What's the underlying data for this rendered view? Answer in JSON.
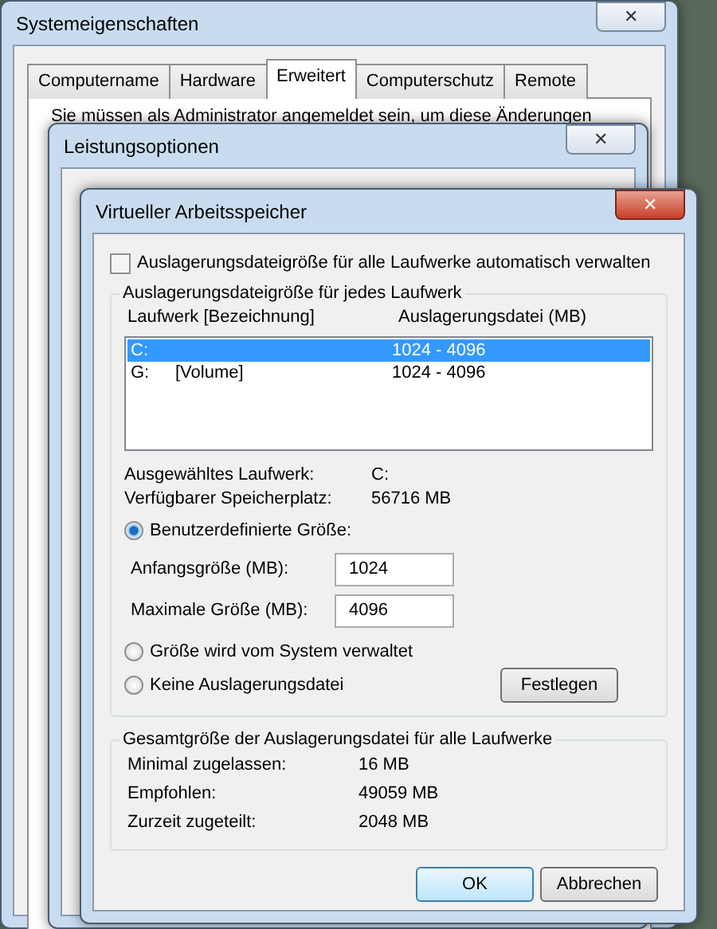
{
  "system_properties": {
    "title": "Systemeigenschaften",
    "close": "✕",
    "tabs": [
      {
        "label": "Computername",
        "selected": false
      },
      {
        "label": "Hardware",
        "selected": false
      },
      {
        "label": "Erweitert",
        "selected": true
      },
      {
        "label": "Computerschutz",
        "selected": false
      },
      {
        "label": "Remote",
        "selected": false
      }
    ],
    "notice": "Sie müssen als Administrator angemeldet sein, um diese Änderungen"
  },
  "performance_options": {
    "title": "Leistungsoptionen",
    "close": "✕"
  },
  "virtual_memory": {
    "title": "Virtueller Arbeitsspeicher",
    "close": "✕",
    "auto_manage": {
      "label": "Auslagerungsdateigröße für alle Laufwerke automatisch verwalten",
      "checked": false
    },
    "per_drive": {
      "legend": "Auslagerungsdateigröße für jedes Laufwerk",
      "columns": [
        "Laufwerk [Bezeichnung]",
        "Auslagerungsdatei (MB)"
      ],
      "rows": [
        {
          "drive": "C:",
          "label": "",
          "size": "1024 - 4096",
          "selected": true
        },
        {
          "drive": "G:",
          "label": "[Volume]",
          "size": "1024 - 4096",
          "selected": false
        }
      ],
      "info": [
        {
          "label": "Ausgewähltes Laufwerk:",
          "value": "C:"
        },
        {
          "label": "Verfügbarer Speicherplatz:",
          "value": "56716 MB"
        }
      ],
      "custom": {
        "label": "Benutzerdefinierte Größe:",
        "selected": true
      },
      "fields": [
        {
          "label": "Anfangsgröße (MB):",
          "value": "1024"
        },
        {
          "label": "Maximale Größe (MB):",
          "value": "4096"
        }
      ],
      "system_managed": {
        "label": "Größe wird vom System verwaltet",
        "selected": false
      },
      "no_file": {
        "label": "Keine Auslagerungsdatei",
        "selected": false
      },
      "set_button": "Festlegen"
    },
    "totals": {
      "legend": "Gesamtgröße der Auslagerungsdatei für alle Laufwerke",
      "rows": [
        {
          "label": "Minimal zugelassen:",
          "value": "16 MB"
        },
        {
          "label": "Empfohlen:",
          "value": "49059 MB"
        },
        {
          "label": "Zurzeit zugeteilt:",
          "value": "2048 MB"
        }
      ]
    },
    "buttons": [
      {
        "label": "OK",
        "default": true
      },
      {
        "label": "Abbrechen",
        "default": false
      }
    ]
  }
}
